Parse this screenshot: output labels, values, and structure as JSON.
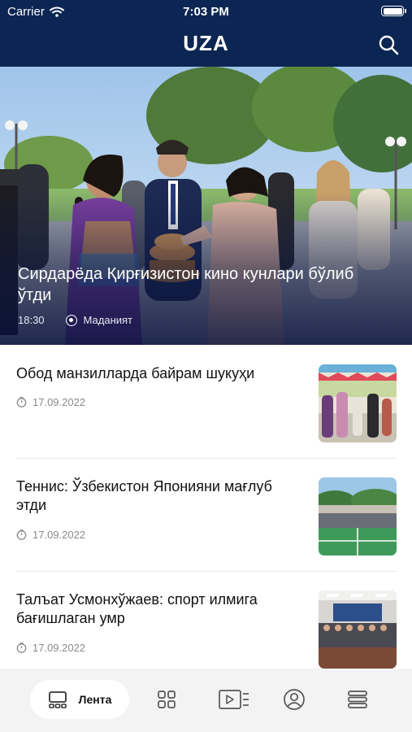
{
  "status_bar": {
    "carrier": "Carrier",
    "time": "7:03 PM"
  },
  "header": {
    "logo": "UZA",
    "search_icon": "search-icon"
  },
  "hero": {
    "title": "Сирдарёда Қирғизистон кино кунлари бўлиб ўтди",
    "time": "18:30",
    "category": "Маданият"
  },
  "news": [
    {
      "title": "Обод манзилларда байрам шукуҳи",
      "date": "17.09.2022"
    },
    {
      "title": "Теннис: Ўзбекистон Японияни мағлуб этди",
      "date": "17.09.2022"
    },
    {
      "title": "Талъат Усмонхўжаев: спорт илмига бағишлаган умр",
      "date": "17.09.2022"
    }
  ],
  "tabbar": {
    "tabs": [
      {
        "label": "Лента",
        "icon": "feed-icon",
        "active": true
      },
      {
        "label": "",
        "icon": "grid-icon",
        "active": false
      },
      {
        "label": "",
        "icon": "video-list-icon",
        "active": false
      },
      {
        "label": "",
        "icon": "profile-icon",
        "active": false
      },
      {
        "label": "",
        "icon": "menu-icon",
        "active": false
      }
    ]
  },
  "colors": {
    "header_bg": "#0c2653",
    "tabbar_bg": "#f3f3f3",
    "date_gray": "#8a8a8a"
  }
}
